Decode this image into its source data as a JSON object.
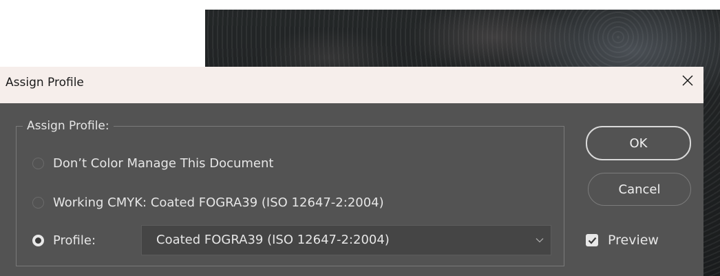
{
  "dialog": {
    "title": "Assign Profile",
    "close_icon": "close-icon",
    "group_label": "Assign Profile:",
    "options": [
      {
        "label": "Don’t Color Manage This Document",
        "selected": false
      },
      {
        "label": "Working CMYK:  Coated FOGRA39 (ISO 12647-2:2004)",
        "selected": false
      },
      {
        "label": "Profile:",
        "selected": true
      }
    ],
    "profile_select": {
      "value": "Coated FOGRA39 (ISO 12647-2:2004)",
      "icon": "chevron-down-icon"
    },
    "ok_label": "OK",
    "cancel_label": "Cancel",
    "preview": {
      "label": "Preview",
      "checked": true
    }
  },
  "colors": {
    "dialog_bg": "#535353",
    "titlebar_bg": "#f6eeeb",
    "text": "#e6e6e6"
  }
}
